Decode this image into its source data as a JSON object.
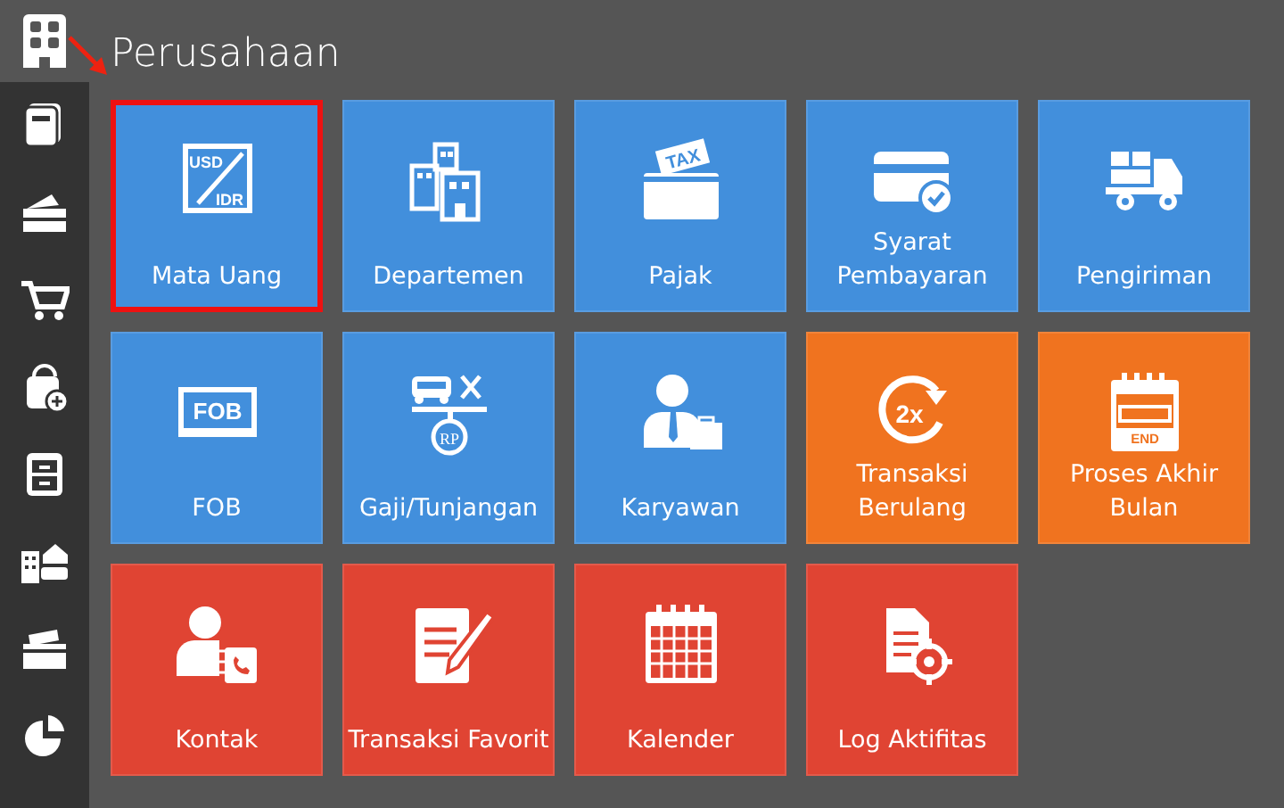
{
  "header": {
    "title": "Perusahaan"
  },
  "tiles": [
    {
      "label": "Mata Uang",
      "color": "#428fdc",
      "selected": true,
      "icon_text": [
        "USD",
        "IDR"
      ]
    },
    {
      "label": "Departemen",
      "color": "#428fdc",
      "selected": false
    },
    {
      "label": "Pajak",
      "color": "#428fdc",
      "selected": false,
      "icon_text": [
        "TAX"
      ]
    },
    {
      "label": "Syarat Pembayaran",
      "color": "#428fdc",
      "selected": false
    },
    {
      "label": "Pengiriman",
      "color": "#428fdc",
      "selected": false
    },
    {
      "label": "FOB",
      "color": "#428fdc",
      "selected": false,
      "icon_text": [
        "FOB"
      ]
    },
    {
      "label": "Gaji/Tunjangan",
      "color": "#428fdc",
      "selected": false,
      "icon_text": [
        "RP"
      ]
    },
    {
      "label": "Karyawan",
      "color": "#428fdc",
      "selected": false
    },
    {
      "label": "Transaksi Berulang",
      "color": "#f0731f",
      "selected": false,
      "icon_text": [
        "2x"
      ]
    },
    {
      "label": "Proses Akhir Bulan",
      "color": "#f0731f",
      "selected": false,
      "icon_text": [
        "END"
      ]
    },
    {
      "label": "Kontak",
      "color": "#e04433",
      "selected": false
    },
    {
      "label": "Transaksi Favorit",
      "color": "#e04433",
      "selected": false
    },
    {
      "label": "Kalender",
      "color": "#e04433",
      "selected": false
    },
    {
      "label": "Log Aktifitas",
      "color": "#e04433",
      "selected": false
    }
  ]
}
